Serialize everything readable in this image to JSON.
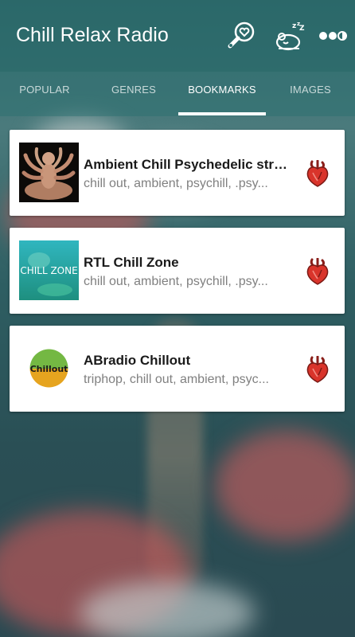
{
  "app_bar": {
    "title": "Chill Relax Radio",
    "icons": [
      "search-heart-icon",
      "sleep-timer-icon",
      "more-options-icon"
    ]
  },
  "tabs": [
    {
      "label": "POPULAR",
      "active": false
    },
    {
      "label": "GENRES",
      "active": false
    },
    {
      "label": "BOOKMARKS",
      "active": true
    },
    {
      "label": "IMAGES",
      "active": false
    }
  ],
  "bookmarks": [
    {
      "title": "Ambient Chill Psychedelic stre...",
      "tags": "chill out, ambient, psychill, .psy...",
      "thumb": "deity-statue-thumbnail",
      "icon": "anatomical-heart-icon"
    },
    {
      "title": "RTL Chill Zone",
      "tags": "chill out, ambient, psychill, .psy...",
      "thumb": "chill-zone-thumbnail",
      "thumb_text": "CHILL ZONE",
      "icon": "anatomical-heart-icon"
    },
    {
      "title": "ABradio Chillout",
      "tags": "triphop, chill out, ambient, psyc...",
      "thumb": "chillout-logo-thumbnail",
      "thumb_text": "Chillout",
      "icon": "anatomical-heart-icon"
    }
  ],
  "colors": {
    "app_bar": "#1e6464",
    "tab_active": "#ffffff",
    "heart_red": "#d9342b",
    "card_bg": "#ffffff"
  }
}
